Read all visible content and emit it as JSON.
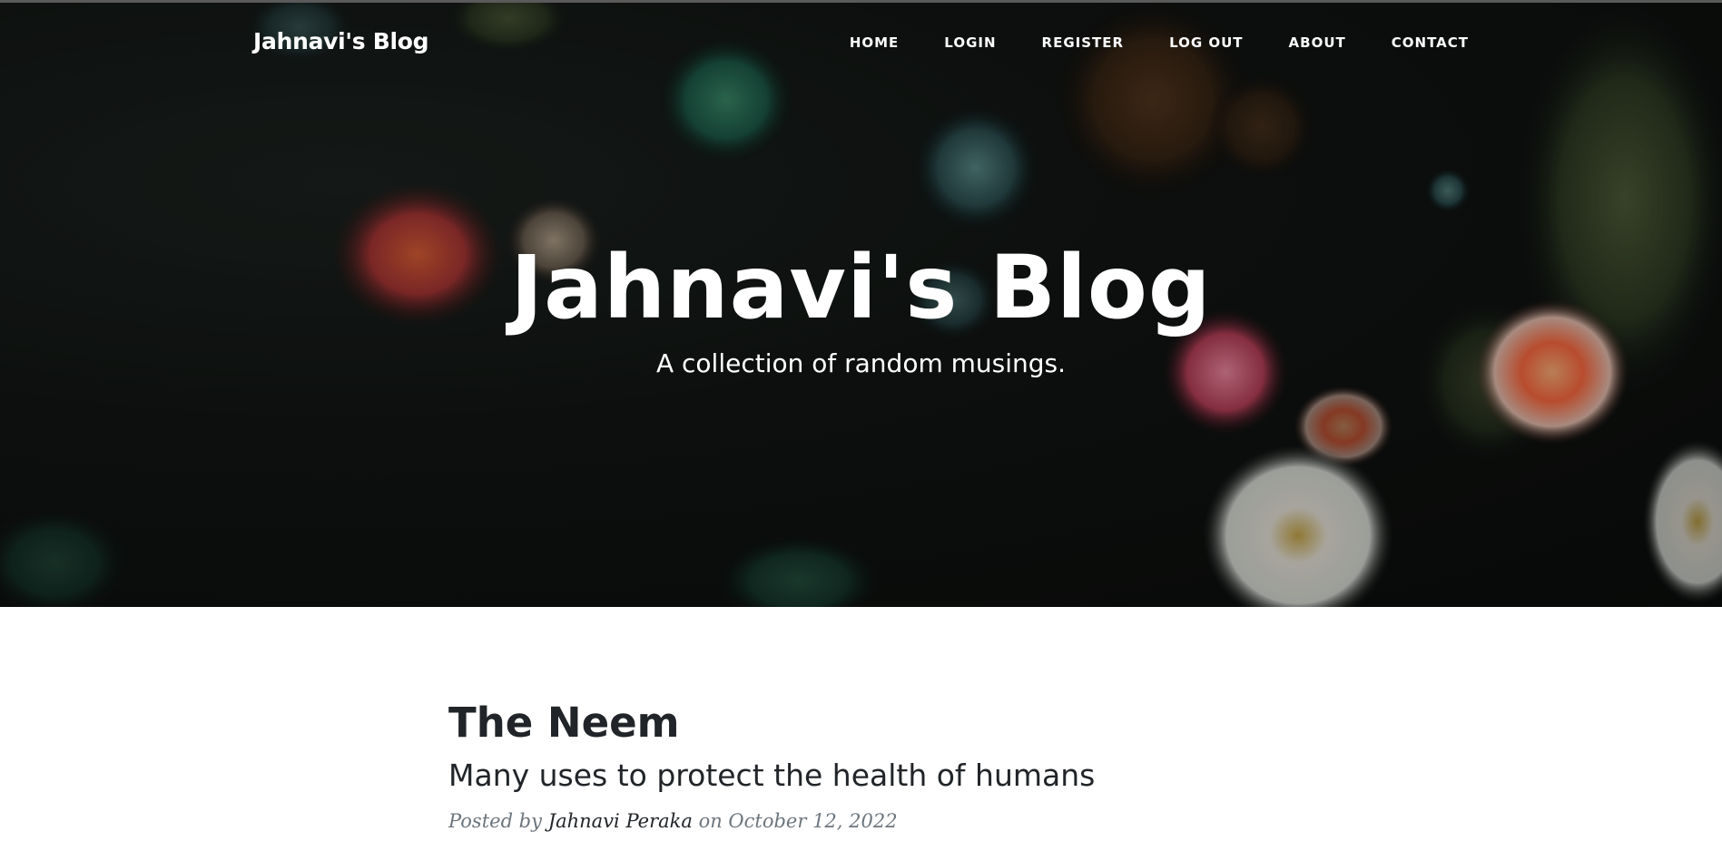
{
  "navbar": {
    "brand": "Jahnavi's Blog",
    "links": [
      {
        "label": "HOME"
      },
      {
        "label": "LOGIN"
      },
      {
        "label": "REGISTER"
      },
      {
        "label": "LOG OUT"
      },
      {
        "label": "ABOUT"
      },
      {
        "label": "CONTACT"
      }
    ]
  },
  "hero": {
    "title": "Jahnavi's Blog",
    "subtitle": "A collection of random musings.",
    "image": "sea-anemones-photo"
  },
  "posts": [
    {
      "title": "The Neem",
      "subtitle": "Many uses to protect the health of humans",
      "meta_prefix": "Posted by",
      "author": "Jahnavi Peraka",
      "meta_on": "on",
      "date": "October 12, 2022"
    }
  ],
  "colors": {
    "text_dark": "#212529",
    "meta_gray": "#6c757d",
    "hero_text": "#ffffff"
  }
}
